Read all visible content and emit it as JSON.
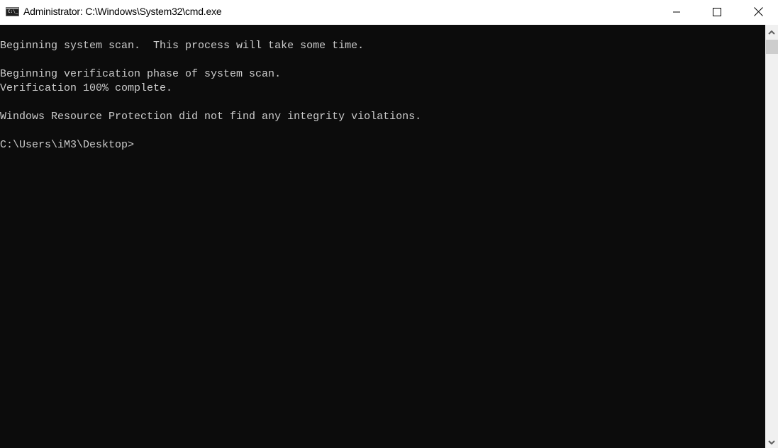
{
  "window": {
    "title": "Administrator: C:\\Windows\\System32\\cmd.exe",
    "icon": "cmd-icon",
    "icon_text": "C:\\_",
    "controls": {
      "minimize": "minimize-icon",
      "maximize": "maximize-icon",
      "close": "close-icon"
    }
  },
  "console": {
    "lines": [
      "Beginning system scan.  This process will take some time.",
      "",
      "Beginning verification phase of system scan.",
      "Verification 100% complete.",
      "",
      "Windows Resource Protection did not find any integrity violations.",
      "",
      "C:\\Users\\iM3\\Desktop>"
    ],
    "background": "#0c0c0c",
    "foreground": "#cccccc"
  },
  "scrollbar": {
    "up": "chevron-up-icon",
    "down": "chevron-down-icon"
  }
}
